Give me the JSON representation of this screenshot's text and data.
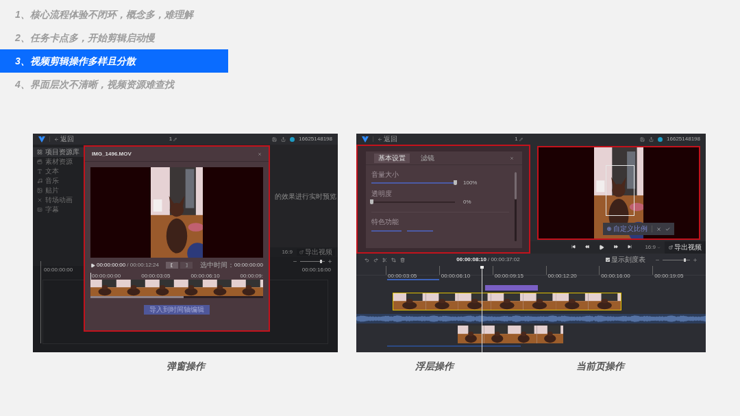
{
  "points": [
    {
      "text": "1、核心流程体验不闭环，概念多，难理解",
      "selected": false
    },
    {
      "text": "2、任务卡点多，开始剪辑启动慢",
      "selected": false
    },
    {
      "text": "3、视频剪辑操作多样且分散",
      "selected": true
    },
    {
      "text": "4、界面层次不清晰，视频资源难查找",
      "selected": false
    }
  ],
  "popup_editor": {
    "topbar": {
      "back": "返回",
      "title": "1",
      "phone": "16625148198"
    },
    "sidebar": [
      {
        "label": "项目资源库",
        "selected": true
      },
      {
        "label": "素材资源",
        "selected": false
      },
      {
        "label": "文本",
        "selected": false
      },
      {
        "label": "音乐",
        "selected": false
      },
      {
        "label": "贴片",
        "selected": false
      },
      {
        "label": "转场动画",
        "selected": false
      },
      {
        "label": "字幕",
        "selected": false
      }
    ],
    "preview_hint": "的效果进行实时预览",
    "ratio": "16:9",
    "export": "导出视频",
    "timeline": {
      "ticks": [
        "00:00:00:00",
        "00:00:16:00"
      ],
      "zoom": {
        "level": 0.85
      }
    },
    "modal": {
      "title": "IMG_1496.MOV",
      "current": "00:00:00:00",
      "total": "/ 00:00:12:24",
      "selected_label": "选中时间：",
      "selected_time": "00:00:00:00",
      "ticks": [
        "00:00:00:00",
        "00:00:03:05",
        "00:00:06:10",
        "00:00:09:"
      ],
      "progress": {
        "level": 0.54
      },
      "button": "导入到时间轴编辑"
    }
  },
  "layer_editor": {
    "topbar": {
      "back": "返回",
      "title": "1",
      "phone": "16625148198"
    },
    "panel": {
      "tabs": [
        {
          "label": "基本设置",
          "selected": true
        },
        {
          "label": "滤镜",
          "selected": false
        }
      ],
      "sliders": [
        {
          "label": "音量大小",
          "level": 1,
          "reading": "100%"
        },
        {
          "label": "透明度",
          "level": 0,
          "reading": "0%"
        }
      ],
      "section": "特色功能"
    },
    "crop_toolbar": {
      "label": "自定义比例"
    },
    "ratio": "16:9",
    "export": "导出视频",
    "timeline": {
      "timecode": "00:00:08:10",
      "duration": "/ 00:00:37:02",
      "show_scale": {
        "label": "显示刻度表",
        "checked": true
      },
      "zoom": {
        "level": 0.8
      },
      "ticks": [
        "00:00:03:05",
        "00:00:06:10",
        "00:00:09:15",
        "00:00:12:20",
        "00:00:16:00",
        "00:00:19:05"
      ]
    }
  },
  "captions": [
    "弹窗操作",
    "浮层操作",
    "当前页操作"
  ]
}
